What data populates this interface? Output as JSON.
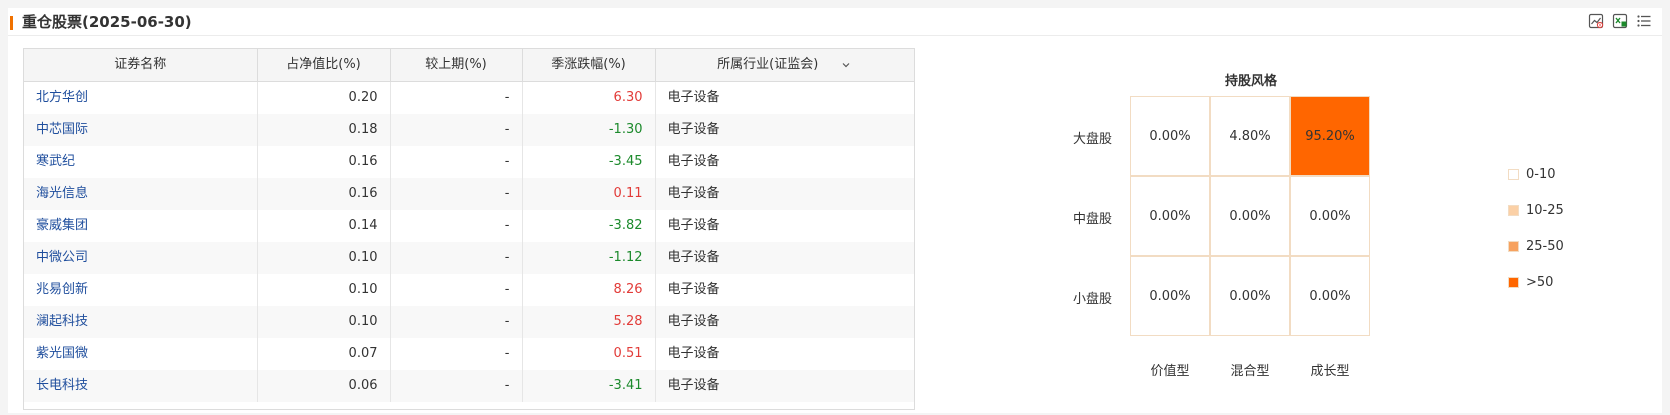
{
  "header": {
    "title": "重仓股票(2025-06-30)",
    "accent": "#f07100"
  },
  "table": {
    "columns": [
      "证券名称",
      "占净值比(%)",
      "较上期(%)",
      "季涨跌幅(%)",
      "所属行业(证监会)"
    ],
    "rows": [
      {
        "name": "北方华创",
        "ratio": "0.20",
        "change": "-",
        "quarter": "6.30",
        "industry": "电子设备",
        "dir": "up"
      },
      {
        "name": "中芯国际",
        "ratio": "0.18",
        "change": "-",
        "quarter": "-1.30",
        "industry": "电子设备",
        "dir": "down"
      },
      {
        "name": "寒武纪",
        "ratio": "0.16",
        "change": "-",
        "quarter": "-3.45",
        "industry": "电子设备",
        "dir": "down"
      },
      {
        "name": "海光信息",
        "ratio": "0.16",
        "change": "-",
        "quarter": "0.11",
        "industry": "电子设备",
        "dir": "up"
      },
      {
        "name": "豪威集团",
        "ratio": "0.14",
        "change": "-",
        "quarter": "-3.82",
        "industry": "电子设备",
        "dir": "down"
      },
      {
        "name": "中微公司",
        "ratio": "0.10",
        "change": "-",
        "quarter": "-1.12",
        "industry": "电子设备",
        "dir": "down"
      },
      {
        "name": "兆易创新",
        "ratio": "0.10",
        "change": "-",
        "quarter": "8.26",
        "industry": "电子设备",
        "dir": "up"
      },
      {
        "name": "澜起科技",
        "ratio": "0.10",
        "change": "-",
        "quarter": "5.28",
        "industry": "电子设备",
        "dir": "up"
      },
      {
        "name": "紫光国微",
        "ratio": "0.07",
        "change": "-",
        "quarter": "0.51",
        "industry": "电子设备",
        "dir": "up"
      },
      {
        "name": "长电科技",
        "ratio": "0.06",
        "change": "-",
        "quarter": "-3.41",
        "industry": "电子设备",
        "dir": "down"
      }
    ],
    "colors": {
      "up": "#e23c39",
      "down": "#1c8a2c",
      "link": "#1f4e9d"
    }
  },
  "style_box": {
    "title": "持股风格",
    "rows": [
      "大盘股",
      "中盘股",
      "小盘股"
    ],
    "cols": [
      "价值型",
      "混合型",
      "成长型"
    ],
    "cells": [
      [
        {
          "text": "0.00%",
          "level": "0-10"
        },
        {
          "text": "4.80%",
          "level": "0-10"
        },
        {
          "text": "95.20%",
          "level": ">50"
        }
      ],
      [
        {
          "text": "0.00%",
          "level": "0-10"
        },
        {
          "text": "0.00%",
          "level": "0-10"
        },
        {
          "text": "0.00%",
          "level": "0-10"
        }
      ],
      [
        {
          "text": "0.00%",
          "level": "0-10"
        },
        {
          "text": "0.00%",
          "level": "0-10"
        },
        {
          "text": "0.00%",
          "level": "0-10"
        }
      ]
    ],
    "legend": [
      {
        "label": "0-10",
        "color": "#ffffff"
      },
      {
        "label": "10-25",
        "color": "#fbd0a6"
      },
      {
        "label": "25-50",
        "color": "#f7a25f"
      },
      {
        "label": ">50",
        "color": "#ff6600"
      }
    ]
  }
}
